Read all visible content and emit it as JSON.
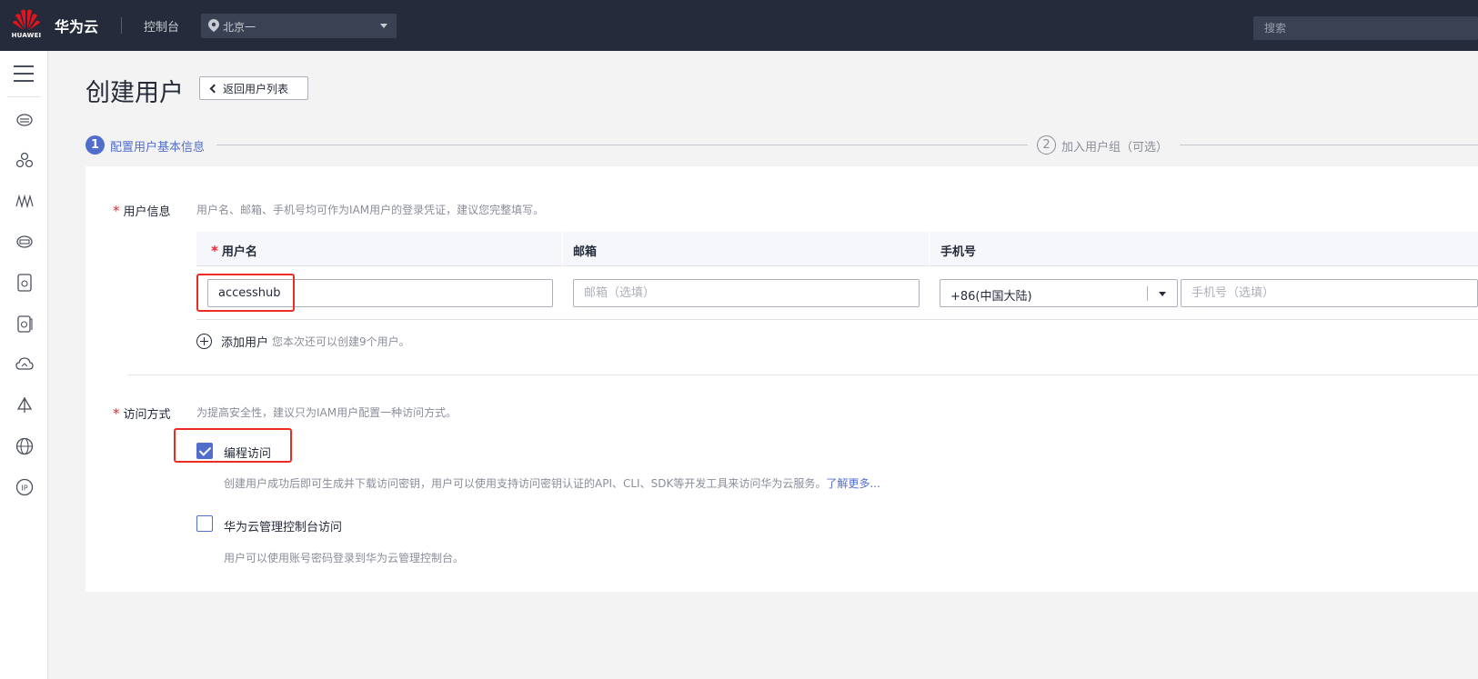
{
  "topbar": {
    "logo_text": "HUAWEI",
    "brand": "华为云",
    "console_link": "控制台",
    "region": "北京一",
    "search_placeholder": "搜索"
  },
  "sidenav": {
    "icons": [
      "menu-icon",
      "cloud-server-icon",
      "cluster-icon",
      "network-icon",
      "database-icon",
      "storage-disk-icon",
      "backup-disk-icon",
      "cloud-icon",
      "sail-icon",
      "globe-icon",
      "ip-icon"
    ]
  },
  "page": {
    "title": "创建用户",
    "back_button": "返回用户列表"
  },
  "steps": [
    {
      "number": "1",
      "label": "配置用户基本信息",
      "active": true
    },
    {
      "number": "2",
      "label": "加入用户组（可选）",
      "active": false
    }
  ],
  "user_info": {
    "label": "用户信息",
    "hint": "用户名、邮箱、手机号均可作为IAM用户的登录凭证，建议您完整填写。",
    "columns": {
      "username": "用户名",
      "email": "邮箱",
      "phone": "手机号"
    },
    "row": {
      "username_value": "accesshub",
      "email_placeholder": "邮箱（选填）",
      "country_code": "+86(中国大陆)",
      "phone_placeholder": "手机号（选填）"
    },
    "add_user_label": "添加用户",
    "add_user_hint": "您本次还可以创建9个用户。"
  },
  "access": {
    "label": "访问方式",
    "hint": "为提高安全性，建议只为IAM用户配置一种访问方式。",
    "options": [
      {
        "label": "编程访问",
        "checked": true,
        "desc": "创建用户成功后即可生成并下载访问密钥，用户可以使用支持访问密钥认证的API、CLI、SDK等开发工具来访问华为云服务。",
        "link": "了解更多..."
      },
      {
        "label": "华为云管理控制台访问",
        "checked": false,
        "desc": "用户可以使用账号密码登录到华为云管理控制台。"
      }
    ]
  },
  "colors": {
    "topbar": "#252b3a",
    "accent": "#526ecc",
    "required": "#f5222d",
    "highlight_box": "#ec2c23"
  }
}
